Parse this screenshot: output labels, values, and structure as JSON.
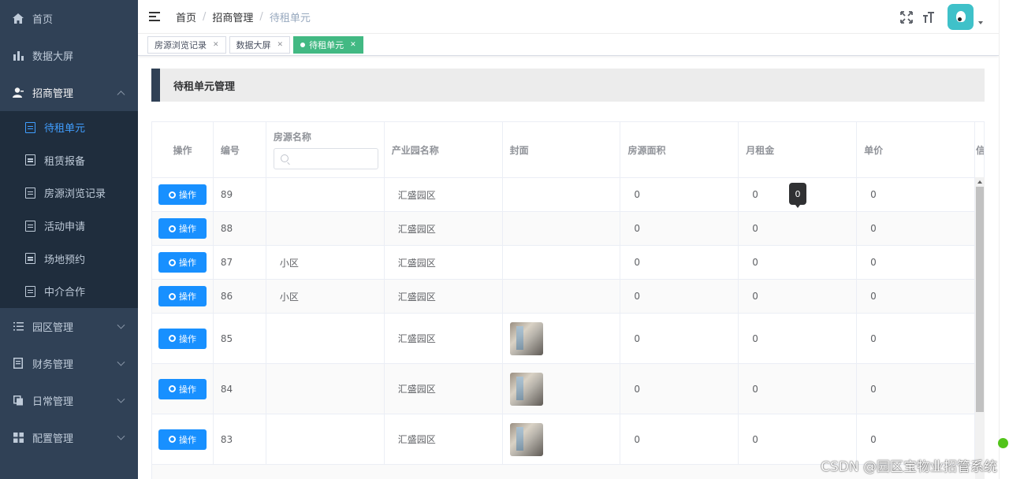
{
  "sidebar": {
    "items": [
      {
        "label": "首页",
        "icon": "home-icon"
      },
      {
        "label": "数据大屏",
        "icon": "bar-chart-icon"
      },
      {
        "label": "招商管理",
        "icon": "user-icon",
        "open": true
      }
    ],
    "submenu": [
      {
        "label": "待租单元",
        "active": true
      },
      {
        "label": "租赁报备"
      },
      {
        "label": "房源浏览记录"
      },
      {
        "label": "活动申请"
      },
      {
        "label": "场地预约"
      },
      {
        "label": "中介合作"
      }
    ],
    "bottom_items": [
      {
        "label": "园区管理",
        "icon": "list-icon"
      },
      {
        "label": "财务管理",
        "icon": "document-icon"
      },
      {
        "label": "日常管理",
        "icon": "copy-icon"
      },
      {
        "label": "配置管理",
        "icon": "grid-icon"
      }
    ]
  },
  "breadcrumb": [
    "首页",
    "招商管理",
    "待租单元"
  ],
  "tags": [
    {
      "label": "房源浏览记录",
      "active": false
    },
    {
      "label": "数据大屏",
      "active": false
    },
    {
      "label": "待租单元",
      "active": true
    }
  ],
  "page_title": "待租单元管理",
  "table": {
    "headers": {
      "op": "操作",
      "id": "编号",
      "name": "房源名称",
      "park": "产业园名称",
      "cover": "封面",
      "area": "房源面积",
      "rent": "月租金",
      "price": "单价",
      "extra": "信"
    },
    "search_placeholder": "",
    "op_button_label": "操作",
    "rows": [
      {
        "id": "89",
        "name": "",
        "park": "汇盛园区",
        "has_cover": false,
        "area": "0",
        "rent": "0",
        "price": "0"
      },
      {
        "id": "88",
        "name": "",
        "park": "汇盛园区",
        "has_cover": false,
        "area": "0",
        "rent": "0",
        "price": "0"
      },
      {
        "id": "87",
        "name": "小区",
        "park": "汇盛园区",
        "has_cover": false,
        "area": "0",
        "rent": "0",
        "price": "0"
      },
      {
        "id": "86",
        "name": "小区",
        "park": "汇盛园区",
        "has_cover": false,
        "area": "0",
        "rent": "0",
        "price": "0"
      },
      {
        "id": "85",
        "name": "",
        "park": "汇盛园区",
        "has_cover": true,
        "area": "0",
        "rent": "0",
        "price": "0"
      },
      {
        "id": "84",
        "name": "",
        "park": "汇盛园区",
        "has_cover": true,
        "area": "0",
        "rent": "0",
        "price": "0"
      },
      {
        "id": "83",
        "name": "",
        "park": "汇盛园区",
        "has_cover": true,
        "area": "0",
        "rent": "0",
        "price": "0"
      }
    ]
  },
  "tooltip_value": "0",
  "watermark": "CSDN @园区宝物业招管系统",
  "colors": {
    "sidebar_bg": "#304156",
    "submenu_bg": "#1f2d3d",
    "active_text": "#409eff",
    "active_tag": "#42b983",
    "button": "#1890ff"
  }
}
